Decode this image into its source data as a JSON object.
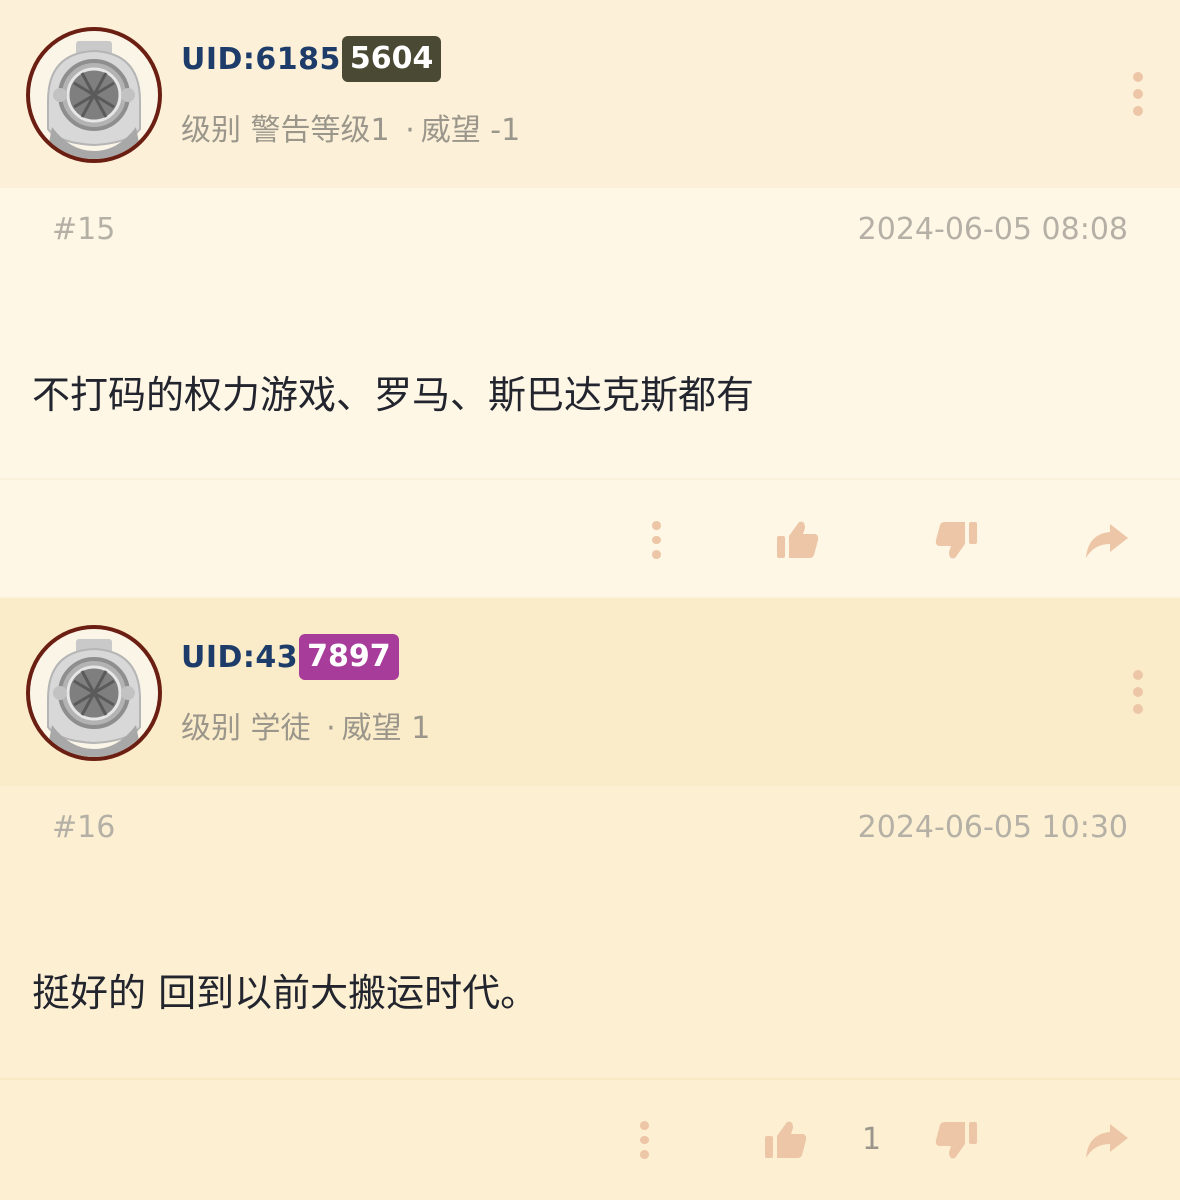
{
  "posts": [
    {
      "uid_prefix": "UID:6185",
      "uid_highlight": "5604",
      "level_label": "级别",
      "level": "警告等级1",
      "separator": "·",
      "reputation_label": "威望",
      "reputation": "-1",
      "floor": "#15",
      "time": "2024-06-05 08:08",
      "content": "不打码的权力游戏、罗马、斯巴达克斯都有",
      "like_count": "",
      "icons": {
        "more": "more-vertical-icon",
        "like": "thumbs-up-icon",
        "dislike": "thumbs-down-icon",
        "share": "share-icon"
      }
    },
    {
      "uid_prefix": "UID:43",
      "uid_highlight": "7897",
      "level_label": "级别",
      "level": "学徒",
      "separator": "·",
      "reputation_label": "威望",
      "reputation": "1",
      "floor": "#16",
      "time": "2024-06-05 10:30",
      "content": "挺好的 回到以前大搬运时代。",
      "like_count": "1",
      "icons": {
        "more": "more-vertical-icon",
        "like": "thumbs-up-icon",
        "dislike": "thumbs-down-icon",
        "share": "share-icon"
      }
    }
  ],
  "colors": {
    "uid_text": "#1d3c6a",
    "badge_1": "#4a4933",
    "badge_2": "#a73c9b",
    "icon_tint": "#ecc6a6",
    "avatar_ring": "#6b1f12"
  }
}
